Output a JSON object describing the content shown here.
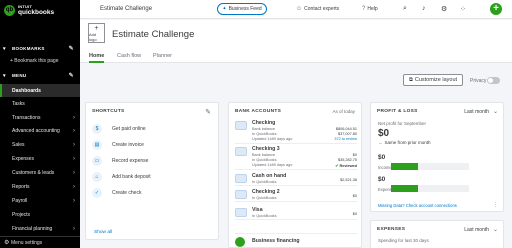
{
  "sidebar": {
    "logo_top": "INTUIT",
    "logo_bottom": "quickbooks",
    "bookmarks_label": "BOOKMARKS",
    "bookmark_this_page": "+ Bookmark this page",
    "menu_label": "MENU",
    "items": [
      {
        "label": "Dashboards",
        "active": true
      },
      {
        "label": "Tasks"
      },
      {
        "label": "Transactions"
      },
      {
        "label": "Advanced accounting"
      },
      {
        "label": "Sales"
      },
      {
        "label": "Expenses"
      },
      {
        "label": "Customers & leads"
      },
      {
        "label": "Reports"
      },
      {
        "label": "Payroll"
      },
      {
        "label": "Projects"
      },
      {
        "label": "Financial planning"
      }
    ],
    "footer_label": "Menu settings"
  },
  "topbar": {
    "title": "Estimate Challenge",
    "business_feed": "Business Feed",
    "contact_experts": "Contact experts",
    "help": "Help",
    "new_label": "+"
  },
  "company": {
    "add_logo": "+ Add logo",
    "add_logo_plus": "+",
    "add_logo_text": "Add logo",
    "name": "Estimate Challenge",
    "tabs": [
      "Home",
      "Cash flow",
      "Planner"
    ]
  },
  "controls": {
    "customize_layout": "Customize layout",
    "privacy": "Privacy"
  },
  "shortcuts": {
    "title": "SHORTCUTS",
    "items": [
      "Get paid online",
      "Create invoice",
      "Record expense",
      "Add bank deposit",
      "Create check"
    ],
    "show_all": "Show all"
  },
  "bank_accounts": {
    "title": "BANK ACCOUNTS",
    "ago": "As of today",
    "accounts": [
      {
        "name": "Checking",
        "row1_label": "Bank balance",
        "row1_val": "$806,044.51",
        "row2_label": "In QuickBooks",
        "row2_val": "$37,007.80",
        "row3_label": "Updated 1489 days ago",
        "row3_link": "372 to review"
      },
      {
        "name": "Checking 3",
        "row1_label": "Bank balance",
        "row1_val": "$0",
        "row2_label": "In QuickBooks",
        "row2_val": "$35,282.75",
        "row3_label": "Updated 1489 days ago",
        "row3_link": "Reviewed"
      },
      {
        "name": "Cash on hand",
        "row1_label": "In QuickBooks",
        "row1_val": "$2,521.38"
      },
      {
        "name": "Checking 2",
        "row1_label": "In QuickBooks",
        "row1_val": "$0"
      },
      {
        "name": "Visa",
        "row1_label": "In QuickBooks",
        "row1_val": "$0"
      }
    ],
    "footer": "Business financing"
  },
  "profit_loss": {
    "title": "PROFIT & LOSS",
    "period": "Last month",
    "subtitle": "Net profit for September",
    "net_profit": "$0",
    "change": "Same from prior month",
    "income_amount": "$0",
    "income_label": "Income",
    "income_fraction": 0.35,
    "expenses_amount": "$0",
    "expenses_label": "Expenses",
    "expenses_fraction": 0.35,
    "link": "Missing Data? Check account connections",
    "colors": {
      "income": "#2ca01c",
      "expenses": "#2ca01c"
    }
  },
  "expenses_card": {
    "title": "EXPENSES",
    "period": "Last month",
    "subtitle": "Spending for last 30 days"
  }
}
